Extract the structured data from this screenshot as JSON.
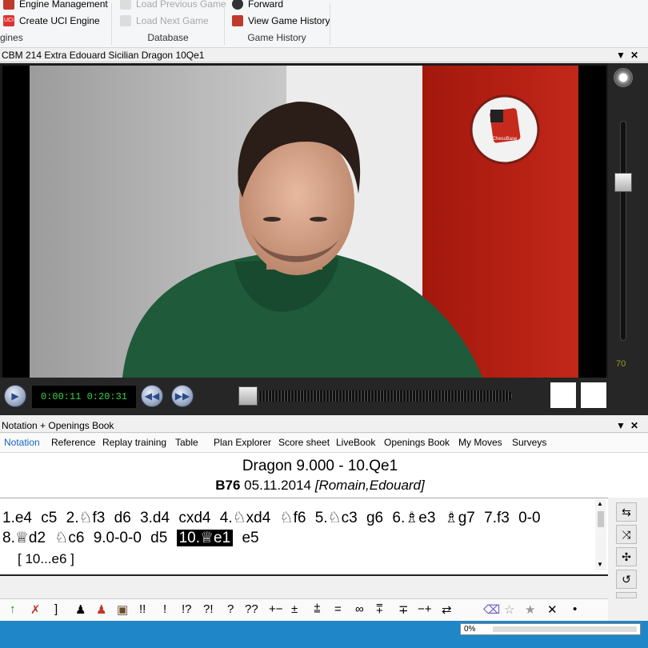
{
  "ribbon": {
    "engines": {
      "engine_management": "Engine Management",
      "create_uci": "Create UCI Engine",
      "group": "gines"
    },
    "database": {
      "load_previous": "Load Previous Game",
      "load_next": "Load Next Game",
      "group": "Database"
    },
    "history": {
      "forward": "Forward",
      "view_history": "View Game History",
      "group": "Game History"
    }
  },
  "video_pane": {
    "title": "CBM 214 Extra Edouard Sicilian Dragon 10Qe1",
    "volume_value": "70",
    "timecode": "0:00:11 0:20:31",
    "logo_text": "ChessBase"
  },
  "notation_pane": {
    "title": "Notation + Openings Book",
    "tabs": [
      "Notation",
      "Reference",
      "Replay training",
      "Table",
      "Plan Explorer",
      "Score sheet",
      "LiveBook",
      "Openings Book",
      "My Moves",
      "Surveys"
    ],
    "active_tab": "Notation",
    "game_title": "Dragon 9.000 - 10.Qe1",
    "eco": "B76",
    "date": "05.11.2014",
    "players": "[Romain,Edouard]",
    "moves_line1": [
      "1.e4",
      "c5",
      "2.♘f3",
      "d6",
      "3.d4",
      "cxd4",
      "4.♘xd4",
      "♘f6",
      "5.♘c3",
      "g6",
      "6.♗e3",
      "♗g7",
      "7.f3",
      "0-0"
    ],
    "moves_line2_before": [
      "8.♕d2",
      "♘c6",
      "9.0-0-0",
      "d5"
    ],
    "current_move": "10.♕e1",
    "moves_line2_after": [
      "e5"
    ],
    "variation": "[ 10...e6 ]"
  },
  "annotations": [
    "!!",
    "!",
    "!?",
    "?!",
    "?",
    "??",
    "+−",
    "±",
    "⩲",
    "=",
    "∞",
    "⩱",
    "∓",
    "−+",
    "⇄"
  ],
  "status": {
    "progress_label": "0%"
  },
  "colors": {
    "accent": "#1565c0",
    "status_bar": "#1f86c8",
    "timecode": "#3ad24a",
    "volume_label": "#9a9a2a"
  }
}
